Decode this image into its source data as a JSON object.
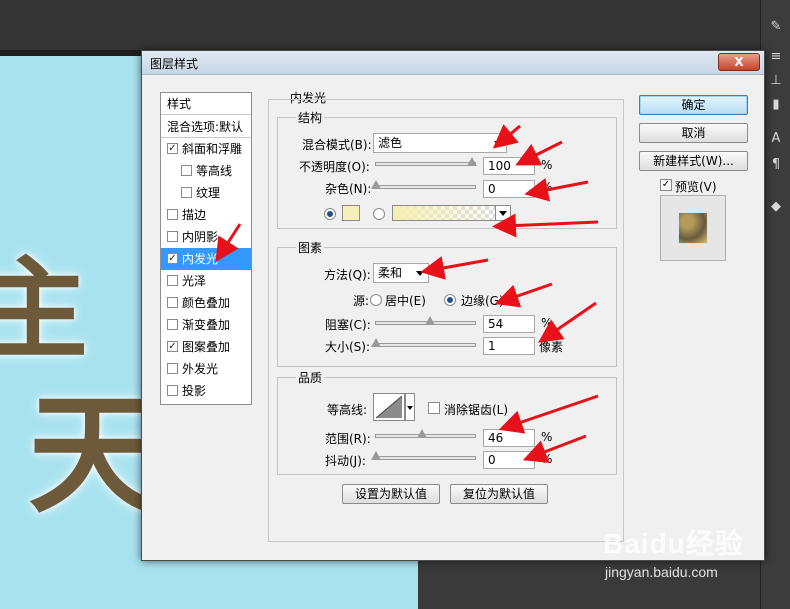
{
  "dialog": {
    "title": "图层样式",
    "close_label": "X"
  },
  "style_list": {
    "header": "样式",
    "blend_options": "混合选项:默认",
    "items": [
      {
        "label": "斜面和浮雕",
        "checked": true
      },
      {
        "label": "等高线",
        "checked": false
      },
      {
        "label": "纹理",
        "checked": false
      },
      {
        "label": "描边",
        "checked": false
      },
      {
        "label": "内阴影",
        "checked": false
      },
      {
        "label": "内发光",
        "checked": true
      },
      {
        "label": "光泽",
        "checked": false
      },
      {
        "label": "颜色叠加",
        "checked": false
      },
      {
        "label": "渐变叠加",
        "checked": false
      },
      {
        "label": "图案叠加",
        "checked": true
      },
      {
        "label": "外发光",
        "checked": false
      },
      {
        "label": "投影",
        "checked": false
      }
    ],
    "active": "内发光",
    "checkmark": "✓"
  },
  "panel": {
    "title": "内发光",
    "structure": {
      "label": "结构",
      "blend_mode_label": "混合模式(B):",
      "blend_mode_value": "滤色",
      "opacity_label": "不透明度(O):",
      "opacity_value": "100",
      "opacity_unit": "%",
      "noise_label": "杂色(N):",
      "noise_value": "0",
      "noise_unit": "%",
      "color_swatch": "#f4f1b8"
    },
    "elements": {
      "label": "图素",
      "technique_label": "方法(Q):",
      "technique_value": "柔和",
      "source_label": "源:",
      "source_center": "居中(E)",
      "source_edge": "边缘(G)",
      "choke_label": "阻塞(C):",
      "choke_value": "54",
      "choke_unit": "%",
      "size_label": "大小(S):",
      "size_value": "1",
      "size_unit": "像素"
    },
    "quality": {
      "label": "品质",
      "contour_label": "等高线:",
      "antialias_label": "消除锯齿(L)",
      "range_label": "范围(R):",
      "range_value": "46",
      "range_unit": "%",
      "jitter_label": "抖动(J):",
      "jitter_value": "0",
      "jitter_unit": "%"
    },
    "make_default": "设置为默认值",
    "reset_default": "复位为默认值"
  },
  "buttons": {
    "ok": "确定",
    "cancel": "取消",
    "new_style": "新建样式(W)...",
    "preview_label": "预览(V)"
  },
  "canvas_text": [
    "主",
    "天"
  ],
  "watermark": {
    "brand": "Baidu经验",
    "url": "jingyan.baidu.com"
  },
  "colors": {
    "canvas_bg": "#a8e2ef",
    "selection": "#3399ff",
    "annotation_arrow": "#e8111a"
  }
}
